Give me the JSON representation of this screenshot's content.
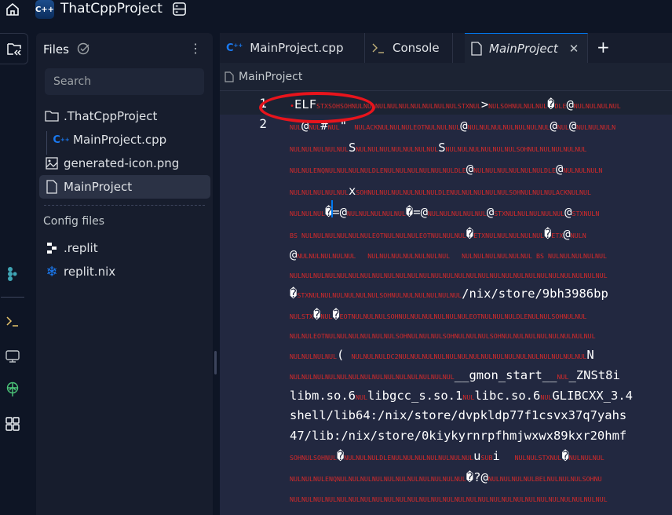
{
  "header": {
    "project_title": "ThatCppProject",
    "logo_text": "C++"
  },
  "sidebar": {
    "title": "Files",
    "search_placeholder": "Search",
    "items": [
      {
        "label": ".ThatCppProject",
        "icon": "folder-icon"
      },
      {
        "label": "MainProject.cpp",
        "icon": "cpp-icon"
      },
      {
        "label": "generated-icon.png",
        "icon": "image-icon"
      },
      {
        "label": "MainProject",
        "icon": "file-icon",
        "selected": true
      }
    ],
    "config_title": "Config files",
    "config_items": [
      {
        "label": ".replit",
        "icon": "replit-icon"
      },
      {
        "label": "replit.nix",
        "icon": "nix-icon"
      }
    ]
  },
  "tabs": [
    {
      "label": "MainProject.cpp",
      "icon": "cpp-icon"
    },
    {
      "label": "Console",
      "icon": "console-icon"
    },
    {
      "label": "MainProject",
      "icon": "file-icon",
      "active": true
    }
  ],
  "breadcrumb": "MainProject",
  "editor": {
    "line_numbers": [
      "1",
      "2"
    ],
    "rows": [
      "ELF{STXSOHSOHNULNULNULNULNULNULNULNULNULSTXNUL}>{NULSOHNULNULNUL}�{DLE}@{NULNULNULNUL}",
      "{NUL}@{NUL}#{NUL}\" {NULACKNULNULNULEOTNULNULNUL}@{NULNULNULNULNULNULNUL}@{NUL}@{NULNULNULN}",
      "{NULNULNULNULNUL}S{NULNULNULNULNULNULNUL}S{NULNULNULNULNULNULSOHNULNULNULNULNUL}",
      "{NULNULENQNULNULNULNULDLENULNULNULNULNULNULDLE}@{NULNULNULNULNULNULDLE}@{NULNULNULN}",
      "{NULNULNULNULNUL}x{SOHNULNULNULNULNULNULDLENULNULNULNULNULSOHNULNULNULACKNULNUL}",
      "{NULNULNUL}�=@{NULNULNULNULNUL}�=@{NULNULNULNULNUL}@{STXNULNULNULNULNUL}@{STXNULN}",
      "{BS NULNULNULNULNULNULEOTNULNULNULEOTNULNULNUL}�{ETXNULNULNULNULNUL}�{ETX}@{NULN}",
      "@{NULNULNULNULNUL   NULNULNULNULNULNULNUL   NULNULNULNULNULNUL BS NULNULNULNULNUL}",
      "{NULNULNULNULNULNULNULNULNULNULNULNULNULNULNULNULNULNULNULNULNULNULNULNULNULNULNUL}",
      "�{STXNULNULNULNULNULNULSOHNULNULNULNULNULNUL}/nix/store/9bh3986bp",
      "{NULSTX}�{NUL}�{EOTNULNULNULSOHNULNULNULNULNULNULEOTNULNULNULDLENULNULSOHNULNUL}",
      "{NULNULEOTNULNULNULNULNULNULSOHNULNULNULSOHNULNULNULSOHNULNULNULNULNULNULNULNUL}",
      "{NULNULNULNUL}( {NULNULNULDC2NULNULNULNULNULNULNULNULNULNULNULNULNULNULNULNUL}N",
      "{NULNULNULNULNULNULNULNULNULNULNULNULNULNUL}__gmon_start__{NUL}_ZNSt8i",
      "libm.so.6{NUL}libgcc_s.so.1{NUL}libc.so.6{NUL}GLIBCXX_3.4",
      "shell/lib64:/nix/store/dvpkldp77f1csvx37q7yahs",
      "47/lib:/nix/store/0kiykyrnrpfhmjwxwx89kxr20hmf",
      "{SOHNULSOHNUL}�{NULNULNULDLENULNULNULNULNULNULNUL}u{SUB}i  {NULNULSTXNUL}�{NULNULNUL}",
      "{NULNULNULENQNULNULNULNULNULNULNULNULNULNULNUL}�?@{NULNULNULNULBELNULNULNULSOHNU}",
      "{NULNULNULNULNULNULNULNULNULNULNULNULNULNULNULNULNULNULNULNULNULNULNULNULNULNULNUL}"
    ]
  },
  "colors": {
    "accent": "#0079f2",
    "control_char": "#d42a2a",
    "annotation": "#e8141c"
  }
}
